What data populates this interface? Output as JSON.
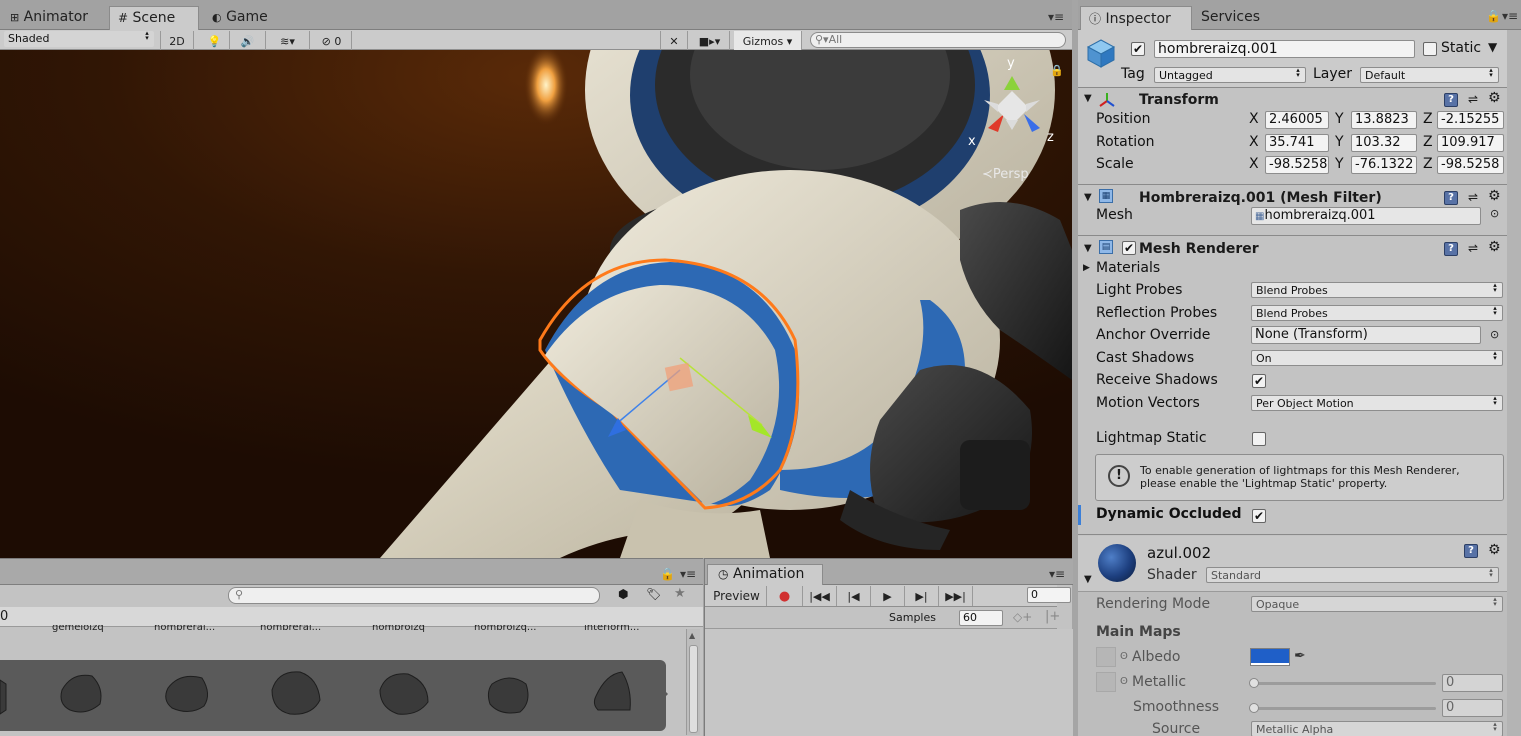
{
  "scene_tabs": [
    {
      "label": "Animator",
      "icon": "animator-icon"
    },
    {
      "label": "Scene",
      "icon": "grid-icon"
    },
    {
      "label": "Game",
      "icon": "game-icon"
    }
  ],
  "scene_toolbar": {
    "shading_mode": "Shaded",
    "mode_2d": "2D",
    "hidden_count": "0",
    "gizmos": "Gizmos",
    "search_placeholder": "All"
  },
  "scene_view": {
    "axis_x": "x",
    "axis_y": "y",
    "axis_z": "z",
    "projection": "Persp"
  },
  "project_panel": {
    "breadcrumb": "0",
    "asset_labels": [
      "gemeloizq",
      "hombrerai...",
      "hombrerai...",
      "hombroizq",
      "hombroizq...",
      "interiorm..."
    ]
  },
  "animation_panel": {
    "tab": "Animation",
    "preview": "Preview",
    "time_value": "0",
    "samples_label": "Samples",
    "samples_value": "60"
  },
  "inspector_tabs": [
    {
      "label": "Inspector",
      "icon": "info-icon"
    },
    {
      "label": "Services",
      "icon": ""
    }
  ],
  "object": {
    "name": "hombreraizq.001",
    "static_label": "Static",
    "tag_label": "Tag",
    "tag_value": "Untagged",
    "layer_label": "Layer",
    "layer_value": "Default"
  },
  "transform": {
    "title": "Transform",
    "rows": [
      {
        "label": "Position",
        "x": "2.46005",
        "y": "13.8823",
        "z": "-2.15255"
      },
      {
        "label": "Rotation",
        "x": "35.741",
        "y": "103.32",
        "z": "109.917"
      },
      {
        "label": "Scale",
        "x": "-98.5258",
        "y": "-76.1322",
        "z": "-98.5258"
      }
    ],
    "axis_labels": [
      "X",
      "Y",
      "Z"
    ]
  },
  "mesh_filter": {
    "title": "Hombreraizq.001 (Mesh Filter)",
    "mesh_label": "Mesh",
    "mesh_value": "hombreraizq.001"
  },
  "mesh_renderer": {
    "title": "Mesh Renderer",
    "materials_label": "Materials",
    "light_probes_label": "Light Probes",
    "light_probes_value": "Blend Probes",
    "reflection_probes_label": "Reflection Probes",
    "reflection_probes_value": "Blend Probes",
    "anchor_override_label": "Anchor Override",
    "anchor_override_value": "None (Transform)",
    "cast_shadows_label": "Cast Shadows",
    "cast_shadows_value": "On",
    "receive_shadows_label": "Receive Shadows",
    "motion_vectors_label": "Motion Vectors",
    "motion_vectors_value": "Per Object Motion",
    "lightmap_static_label": "Lightmap Static",
    "info_message": "To enable generation of lightmaps for this Mesh Renderer, please enable the 'Lightmap Static' property.",
    "dynamic_occluded_label": "Dynamic Occluded"
  },
  "material": {
    "name": "azul.002",
    "shader_label": "Shader",
    "shader_value": "Standard",
    "rendering_mode_label": "Rendering Mode",
    "rendering_mode_value": "Opaque",
    "main_maps_label": "Main Maps",
    "albedo_label": "Albedo",
    "albedo_color": "#1f5fc8",
    "metallic_label": "Metallic",
    "metallic_value": "0",
    "smoothness_label": "Smoothness",
    "smoothness_value": "0",
    "source_label": "Source",
    "source_value": "Metallic Alpha"
  }
}
